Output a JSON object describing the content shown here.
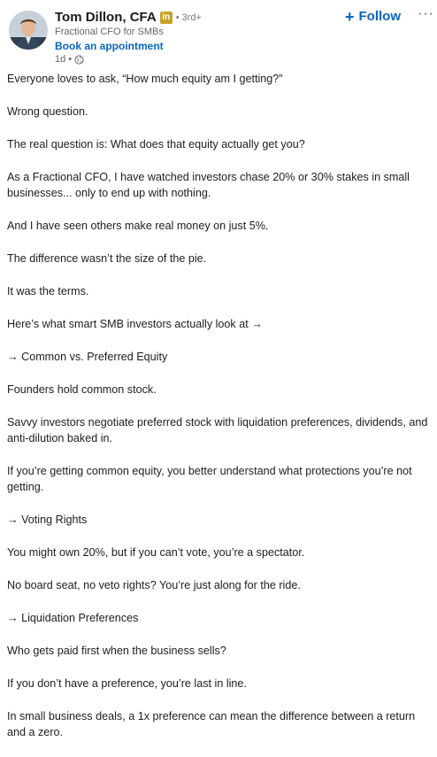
{
  "author": {
    "name": "Tom Dillon, CFA",
    "badge": "in",
    "degree": "• 3rd+",
    "headline": "Fractional CFO for SMBs",
    "appointment_link": "Book an appointment",
    "time": "1d •",
    "visibility_icon": "globe-icon"
  },
  "actions": {
    "follow_plus": "+",
    "follow_label": "Follow",
    "more_label": "···"
  },
  "colors": {
    "link_blue": "#0a66c2",
    "badge_gold": "#c9a227",
    "text": "#1d1d1d",
    "muted": "#666666"
  },
  "post": {
    "paragraphs": [
      "Everyone loves to ask, “How much equity am I getting?”",
      "Wrong question.",
      "The real question is: What does that equity actually get you?",
      "As a Fractional CFO, I have watched investors chase 20% or 30% stakes in small businesses... only to end up with nothing.",
      "And I have seen others make real money on just 5%.",
      "The difference wasn’t the size of the pie.",
      "It was the terms.",
      "Here’s what smart SMB investors actually look at →",
      "→ Common vs. Preferred Equity",
      "Founders hold common stock.",
      "Savvy investors negotiate preferred stock with liquidation preferences, dividends, and anti-dilution baked in.",
      "If you’re getting common equity, you better understand what protections you’re not getting.",
      "→ Voting Rights",
      "You might own 20%, but if you can’t vote, you’re a spectator.",
      "No board seat, no veto rights? You’re just along for the ride.",
      "→ Liquidation Preferences",
      "Who gets paid first when the business sells?",
      "If you don’t have a preference, you’re last in line.",
      "In small business deals, a 1x preference can mean the difference between a return and a zero."
    ]
  }
}
